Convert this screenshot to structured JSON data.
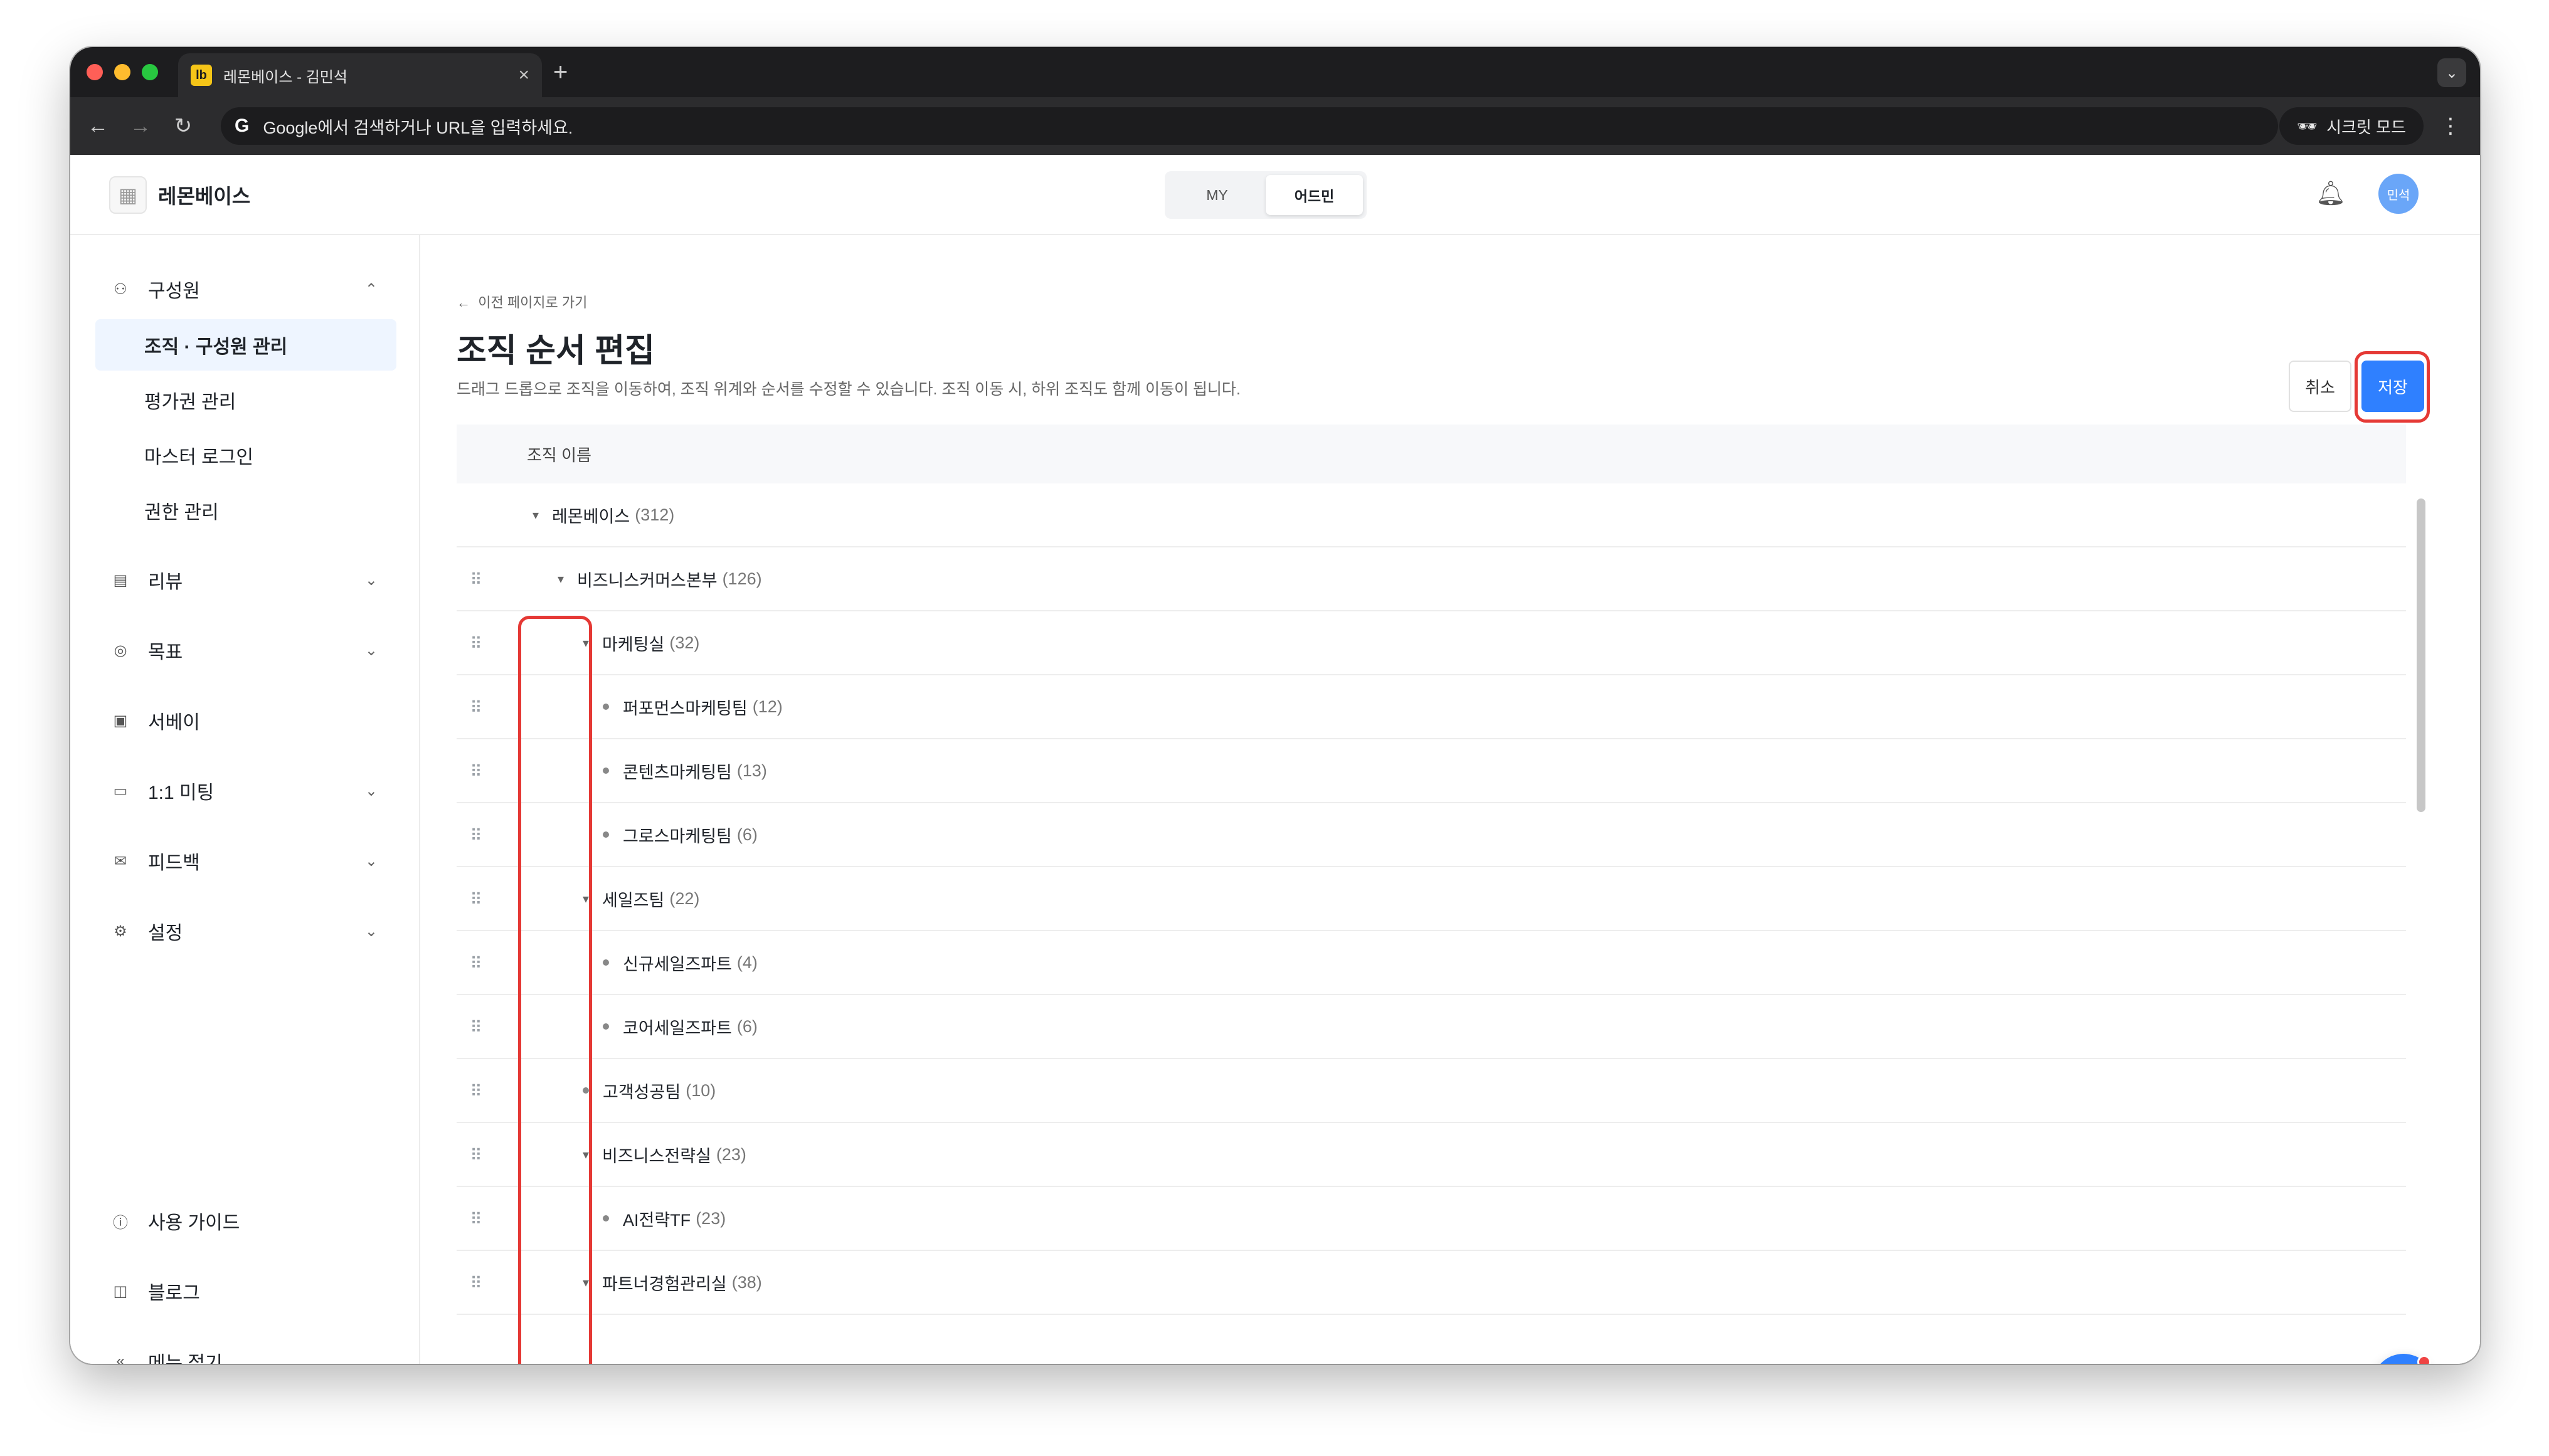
{
  "browser": {
    "tab_title": "레몬베이스 - 김민석",
    "favicon_text": "lb",
    "new_tab": "+",
    "omnibox_text": "Google에서 검색하거나 URL을 입력하세요.",
    "incognito_label": "시크릿 모드"
  },
  "header": {
    "brand": "레몬베이스",
    "mode_tabs": [
      "MY",
      "어드민"
    ],
    "active_mode": "어드민",
    "avatar_text": "민석"
  },
  "sidebar": {
    "group_members": "구성원",
    "sub_items": [
      "조직 · 구성원 관리",
      "평가권 관리",
      "마스터 로그인",
      "권한 관리"
    ],
    "groups": [
      "리뷰",
      "목표",
      "서베이",
      "1:1 미팅",
      "피드백",
      "설정"
    ],
    "footer": [
      "사용 가이드",
      "블로그",
      "메뉴 접기"
    ]
  },
  "main": {
    "back_link": "이전 페이지로 가기",
    "title": "조직 순서 편집",
    "description": "드래그 드롭으로 조직을 이동하여, 조직 위계와 순서를 수정할 수 있습니다. 조직 이동 시, 하위 조직도 함께 이동이 됩니다.",
    "cancel_label": "취소",
    "save_label": "저장",
    "column_header": "조직 이름",
    "org_tree": [
      {
        "name": "레몬베이스",
        "count": "(312)",
        "level": 0,
        "type": "expanded",
        "draggable": false
      },
      {
        "name": "비즈니스커머스본부",
        "count": "(126)",
        "level": 1,
        "type": "expanded",
        "draggable": true
      },
      {
        "name": "마케팅실",
        "count": "(32)",
        "level": 2,
        "type": "expanded",
        "draggable": true
      },
      {
        "name": "퍼포먼스마케팅팀",
        "count": "(12)",
        "level": 3,
        "type": "leaf",
        "draggable": true
      },
      {
        "name": "콘텐츠마케팅팀",
        "count": "(13)",
        "level": 3,
        "type": "leaf",
        "draggable": true
      },
      {
        "name": "그로스마케팅팀",
        "count": "(6)",
        "level": 3,
        "type": "leaf",
        "draggable": true
      },
      {
        "name": "세일즈팀",
        "count": "(22)",
        "level": 2,
        "type": "expanded",
        "draggable": true
      },
      {
        "name": "신규세일즈파트",
        "count": "(4)",
        "level": 3,
        "type": "leaf",
        "draggable": true
      },
      {
        "name": "코어세일즈파트",
        "count": "(6)",
        "level": 3,
        "type": "leaf",
        "draggable": true
      },
      {
        "name": "고객성공팀",
        "count": "(10)",
        "level": 2,
        "type": "leaf",
        "draggable": true
      },
      {
        "name": "비즈니스전략실",
        "count": "(23)",
        "level": 2,
        "type": "expanded",
        "draggable": true
      },
      {
        "name": "AI전략TF",
        "count": "(23)",
        "level": 3,
        "type": "leaf",
        "draggable": true
      },
      {
        "name": "파트너경험관리실",
        "count": "(38)",
        "level": 2,
        "type": "expanded",
        "draggable": true
      }
    ]
  },
  "colors": {
    "accent": "#2f80ff",
    "highlight": "#e53935",
    "active_nav_bg": "#eef5ff"
  }
}
